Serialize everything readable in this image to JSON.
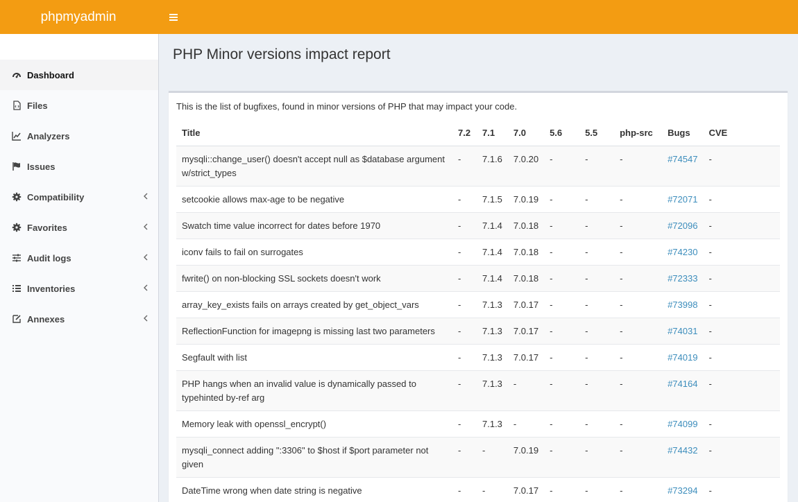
{
  "header": {
    "logo": "phpmyadmin",
    "menu_toggle": "≡"
  },
  "sidebar": {
    "items": [
      {
        "label": "Dashboard",
        "icon": "dashboard-icon",
        "active": true
      },
      {
        "label": "Files",
        "icon": "file-code-icon"
      },
      {
        "label": "Analyzers",
        "icon": "line-chart-icon"
      },
      {
        "label": "Issues",
        "icon": "flag-icon"
      },
      {
        "label": "Compatibility",
        "icon": "gear-icon",
        "expandable": true
      },
      {
        "label": "Favorites",
        "icon": "gear-icon",
        "expandable": true
      },
      {
        "label": "Audit logs",
        "icon": "sliders-icon",
        "expandable": true
      },
      {
        "label": "Inventories",
        "icon": "list-icon",
        "expandable": true
      },
      {
        "label": "Annexes",
        "icon": "edit-icon",
        "expandable": true
      }
    ]
  },
  "main": {
    "title": "PHP Minor versions impact report",
    "intro": "This is the list of bugfixes, found in minor versions of PHP that may impact your code.",
    "table": {
      "columns": [
        "Title",
        "7.2",
        "7.1",
        "7.0",
        "5.6",
        "5.5",
        "php-src",
        "Bugs",
        "CVE"
      ],
      "rows": [
        {
          "title": "mysqli::change_user() doesn't accept null as $database argument w/strict_types",
          "v72": "-",
          "v71": "7.1.6",
          "v70": "7.0.20",
          "v56": "-",
          "v55": "-",
          "src": "-",
          "bug": "#74547",
          "cve": "-"
        },
        {
          "title": "setcookie allows max-age to be negative",
          "v72": "-",
          "v71": "7.1.5",
          "v70": "7.0.19",
          "v56": "-",
          "v55": "-",
          "src": "-",
          "bug": "#72071",
          "cve": "-"
        },
        {
          "title": "Swatch time value incorrect for dates before 1970",
          "v72": "-",
          "v71": "7.1.4",
          "v70": "7.0.18",
          "v56": "-",
          "v55": "-",
          "src": "-",
          "bug": "#72096",
          "cve": "-"
        },
        {
          "title": "iconv fails to fail on surrogates",
          "v72": "-",
          "v71": "7.1.4",
          "v70": "7.0.18",
          "v56": "-",
          "v55": "-",
          "src": "-",
          "bug": "#74230",
          "cve": "-"
        },
        {
          "title": "fwrite() on non-blocking SSL sockets doesn't work",
          "v72": "-",
          "v71": "7.1.4",
          "v70": "7.0.18",
          "v56": "-",
          "v55": "-",
          "src": "-",
          "bug": "#72333",
          "cve": "-"
        },
        {
          "title": "array_key_exists fails on arrays created by get_object_vars",
          "v72": "-",
          "v71": "7.1.3",
          "v70": "7.0.17",
          "v56": "-",
          "v55": "-",
          "src": "-",
          "bug": "#73998",
          "cve": "-"
        },
        {
          "title": "ReflectionFunction for imagepng is missing last two parameters",
          "v72": "-",
          "v71": "7.1.3",
          "v70": "7.0.17",
          "v56": "-",
          "v55": "-",
          "src": "-",
          "bug": "#74031",
          "cve": "-"
        },
        {
          "title": "Segfault with list",
          "v72": "-",
          "v71": "7.1.3",
          "v70": "7.0.17",
          "v56": "-",
          "v55": "-",
          "src": "-",
          "bug": "#74019",
          "cve": "-"
        },
        {
          "title": "PHP hangs when an invalid value is dynamically passed to typehinted by-ref arg",
          "v72": "-",
          "v71": "7.1.3",
          "v70": "-",
          "v56": "-",
          "v55": "-",
          "src": "-",
          "bug": "#74164",
          "cve": "-"
        },
        {
          "title": "Memory leak with openssl_encrypt()",
          "v72": "-",
          "v71": "7.1.3",
          "v70": "-",
          "v56": "-",
          "v55": "-",
          "src": "-",
          "bug": "#74099",
          "cve": "-"
        },
        {
          "title": "mysqli_connect adding \":3306\" to $host if $port parameter not given",
          "v72": "-",
          "v71": "-",
          "v70": "7.0.19",
          "v56": "-",
          "v55": "-",
          "src": "-",
          "bug": "#74432",
          "cve": "-"
        },
        {
          "title": "DateTime wrong when date string is negative",
          "v72": "-",
          "v71": "-",
          "v70": "7.0.17",
          "v56": "-",
          "v55": "-",
          "src": "-",
          "bug": "#73294",
          "cve": "-"
        }
      ]
    }
  },
  "colors": {
    "header_bg": "#f39c12",
    "link": "#3c8dbc",
    "content_bg": "#ecf0f5"
  }
}
